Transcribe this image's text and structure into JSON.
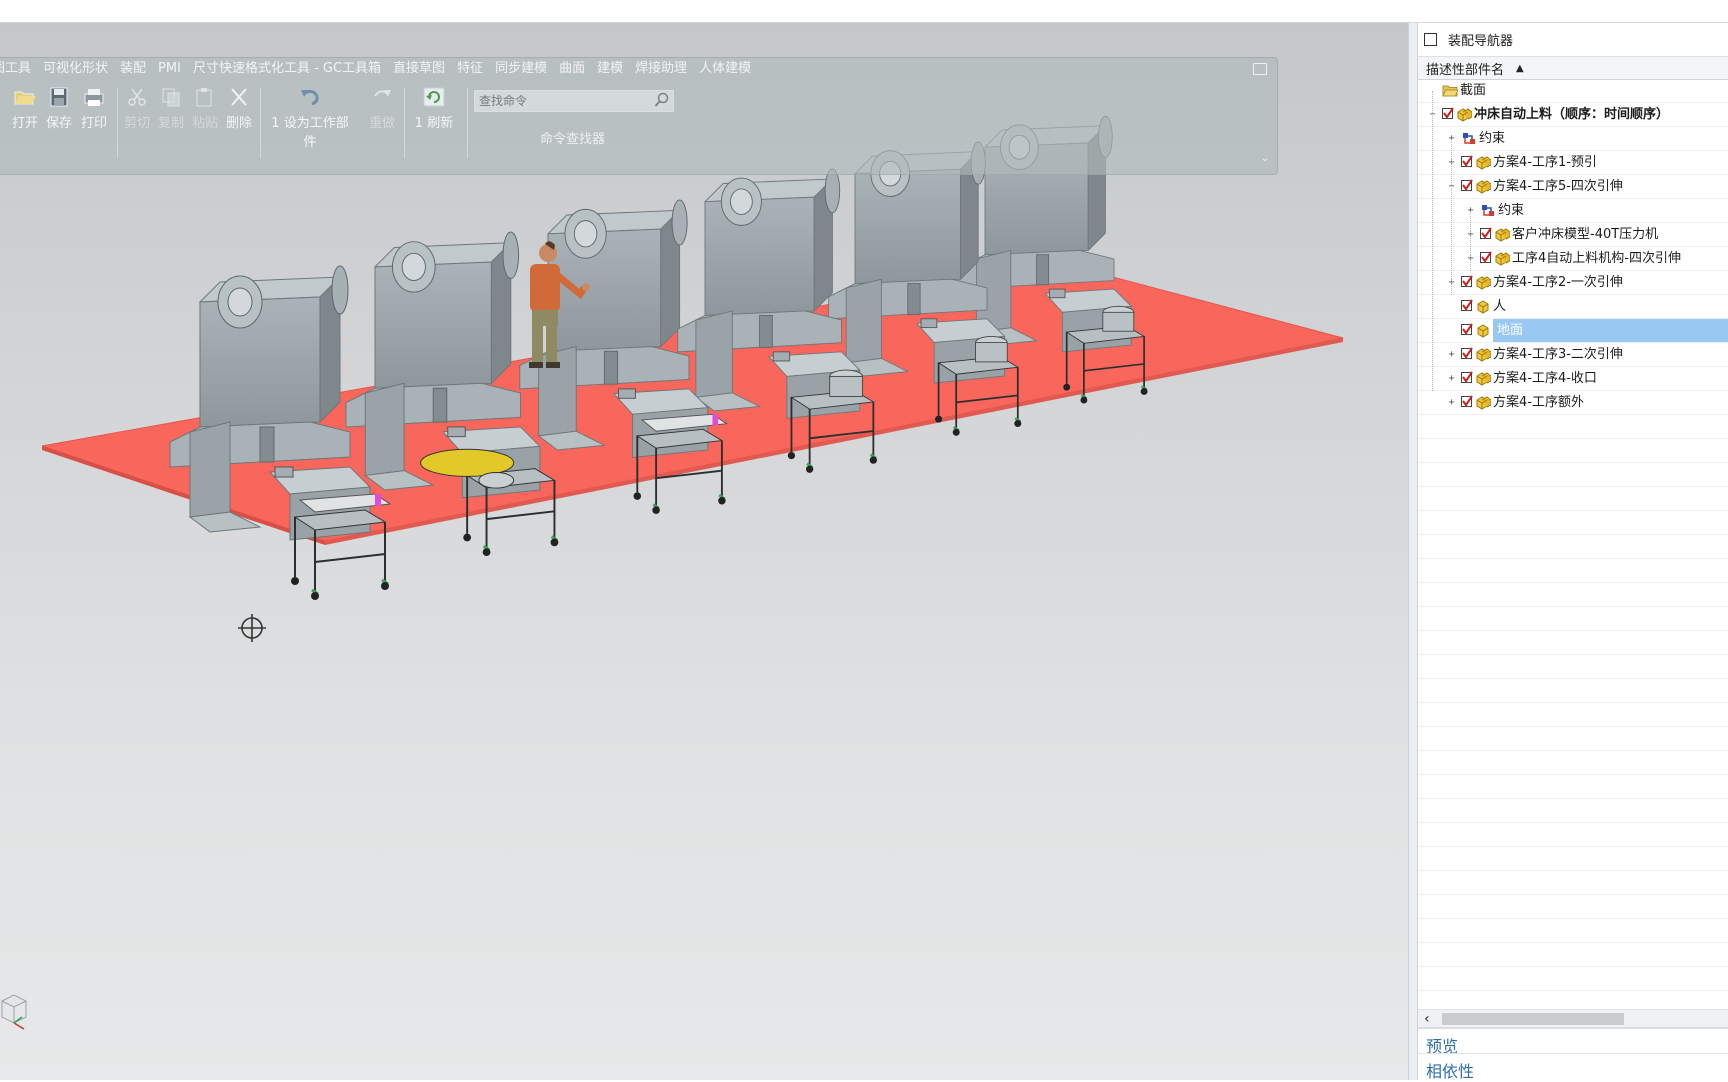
{
  "ribbon": {
    "tabs": [
      "图工具",
      "可视化形状",
      "装配",
      "PMI",
      "尺寸快速格式化工具 - GC工具箱",
      "直接草图",
      "特征",
      "同步建模",
      "曲面",
      "建模",
      "焊接助理",
      "人体建模"
    ],
    "buttons": {
      "open": "打开",
      "save": "保存",
      "print": "打印",
      "cut": "剪切",
      "copy": "复制",
      "paste": "粘贴",
      "delete": "删除",
      "set_work_part": "设为工作部件",
      "set_work_part_prefix": "1",
      "redo": "重做",
      "refresh": "刷新",
      "refresh_prefix": "1"
    },
    "command_search_placeholder": "查找命令",
    "command_finder_label": "命令查找器"
  },
  "navigator": {
    "title": "装配导航器",
    "column_header": "描述性部件名",
    "sort_indicator": "▲",
    "rows": [
      {
        "label": "截面"
      },
      {
        "label": "冲床自动上料（顺序：时间顺序）"
      },
      {
        "label": "约束"
      },
      {
        "label": "方案4-工序1-预引"
      },
      {
        "label": "方案4-工序5-四次引伸"
      },
      {
        "label": "约束"
      },
      {
        "label": "客户冲床模型-40T压力机"
      },
      {
        "label": "工序4自动上料机构-四次引伸"
      },
      {
        "label": "方案4-工序2-一次引伸"
      },
      {
        "label": "人"
      },
      {
        "label": "地面"
      },
      {
        "label": "方案4-工序3-二次引伸"
      },
      {
        "label": "方案4-工序4-收口"
      },
      {
        "label": "方案4-工序额外"
      }
    ],
    "sections": {
      "preview": "预览",
      "dependencies": "相依性"
    }
  },
  "colors": {
    "floor": "#f9675c",
    "machine": "#a4aeb2",
    "selection": "#99c9f2",
    "link": "#2f6ea8"
  }
}
